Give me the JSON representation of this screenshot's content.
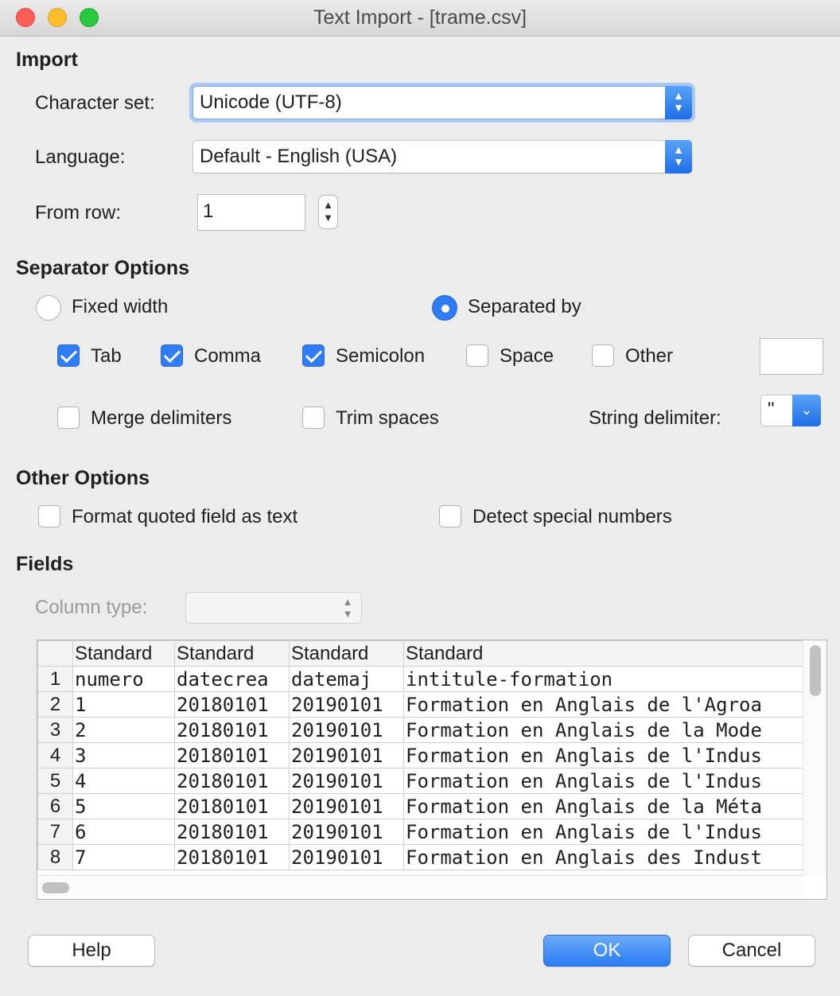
{
  "window": {
    "title": "Text Import - [trame.csv]"
  },
  "import": {
    "heading": "Import",
    "charset_label": "Character set:",
    "charset_value": "Unicode (UTF-8)",
    "language_label": "Language:",
    "language_value": "Default - English (USA)",
    "from_row_label": "From row:",
    "from_row_value": "1"
  },
  "separator": {
    "heading": "Separator Options",
    "fixed_width": "Fixed width",
    "separated_by": "Separated by",
    "tab": "Tab",
    "comma": "Comma",
    "semicolon": "Semicolon",
    "space": "Space",
    "other": "Other",
    "other_value": "",
    "merge": "Merge delimiters",
    "trim": "Trim spaces",
    "string_delim_label": "String delimiter:",
    "string_delim_value": "\""
  },
  "other_options": {
    "heading": "Other Options",
    "format_quoted": "Format quoted field as text",
    "detect_special": "Detect special numbers"
  },
  "fields": {
    "heading": "Fields",
    "column_type_label": "Column type:",
    "column_type_value": "",
    "headers": [
      "Standard",
      "Standard",
      "Standard",
      "Standard"
    ],
    "row_numbers": [
      "1",
      "2",
      "3",
      "4",
      "5",
      "6",
      "7",
      "8"
    ],
    "rows": [
      [
        "numero",
        "datecrea",
        "datemaj",
        "intitule-formation"
      ],
      [
        "1",
        "20180101",
        "20190101",
        "Formation en Anglais de l'Agroa"
      ],
      [
        "2",
        "20180101",
        "20190101",
        "Formation en Anglais de la Mode"
      ],
      [
        "3",
        "20180101",
        "20190101",
        "Formation en Anglais de l'Indus"
      ],
      [
        "4",
        "20180101",
        "20190101",
        "Formation en Anglais de l'Indus"
      ],
      [
        "5",
        "20180101",
        "20190101",
        "Formation en Anglais de la Méta"
      ],
      [
        "6",
        "20180101",
        "20190101",
        "Formation en Anglais de l'Indus"
      ],
      [
        "7",
        "20180101",
        "20190101",
        "Formation en Anglais des Indust"
      ]
    ]
  },
  "buttons": {
    "help": "Help",
    "ok": "OK",
    "cancel": "Cancel"
  },
  "colors": {
    "accent": "#2f7cf6",
    "close": "#fd5f57",
    "minimize": "#febc2e",
    "zoom": "#28c840"
  },
  "icons": {
    "spinner": "up-down-chevron-icon",
    "dropdown": "chevron-down-icon",
    "check": "checkmark-icon"
  }
}
